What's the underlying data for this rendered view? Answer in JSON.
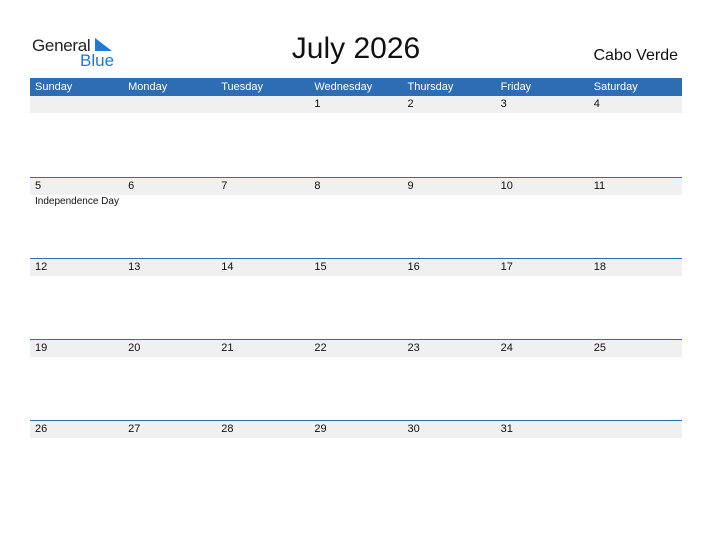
{
  "logo": {
    "text_general": "General",
    "text_blue": "Blue",
    "accent_color": "#1f7ad0"
  },
  "title": "July 2026",
  "country": "Cabo Verde",
  "header_color": "#2e6db4",
  "weekdays": [
    "Sunday",
    "Monday",
    "Tuesday",
    "Wednesday",
    "Thursday",
    "Friday",
    "Saturday"
  ],
  "weeks": [
    {
      "days": [
        "",
        "",
        "",
        "1",
        "2",
        "3",
        "4"
      ],
      "events": [
        "",
        "",
        "",
        "",
        "",
        "",
        ""
      ]
    },
    {
      "days": [
        "5",
        "6",
        "7",
        "8",
        "9",
        "10",
        "11"
      ],
      "events": [
        "Independence Day",
        "",
        "",
        "",
        "",
        "",
        ""
      ]
    },
    {
      "days": [
        "12",
        "13",
        "14",
        "15",
        "16",
        "17",
        "18"
      ],
      "events": [
        "",
        "",
        "",
        "",
        "",
        "",
        ""
      ]
    },
    {
      "days": [
        "19",
        "20",
        "21",
        "22",
        "23",
        "24",
        "25"
      ],
      "events": [
        "",
        "",
        "",
        "",
        "",
        "",
        ""
      ]
    },
    {
      "days": [
        "26",
        "27",
        "28",
        "29",
        "30",
        "31",
        ""
      ],
      "events": [
        "",
        "",
        "",
        "",
        "",
        "",
        ""
      ]
    }
  ]
}
